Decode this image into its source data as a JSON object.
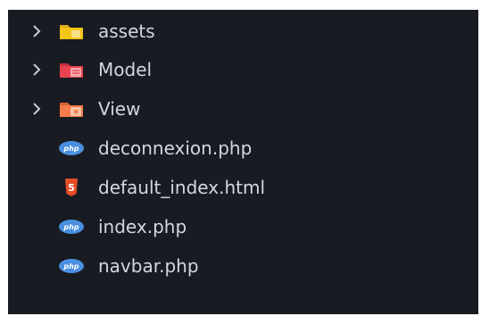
{
  "explorer": {
    "items": [
      {
        "label": "assets",
        "kind": "folder",
        "icon": "folder-assets-icon",
        "expanded": false,
        "color": "#f5c518"
      },
      {
        "label": "Model",
        "kind": "folder",
        "icon": "folder-model-icon",
        "expanded": false,
        "color": "#e8434f"
      },
      {
        "label": "View",
        "kind": "folder",
        "icon": "folder-view-icon",
        "expanded": false,
        "color": "#f57b4c"
      },
      {
        "label": "deconnexion.php",
        "kind": "file",
        "icon": "php-icon",
        "color": "#4a8fe0"
      },
      {
        "label": "default_index.html",
        "kind": "file",
        "icon": "html5-icon",
        "color": "#e44d26"
      },
      {
        "label": "index.php",
        "kind": "file",
        "icon": "php-icon",
        "color": "#4a8fe0"
      },
      {
        "label": "navbar.php",
        "kind": "file",
        "icon": "php-icon",
        "color": "#4a8fe0"
      }
    ]
  }
}
